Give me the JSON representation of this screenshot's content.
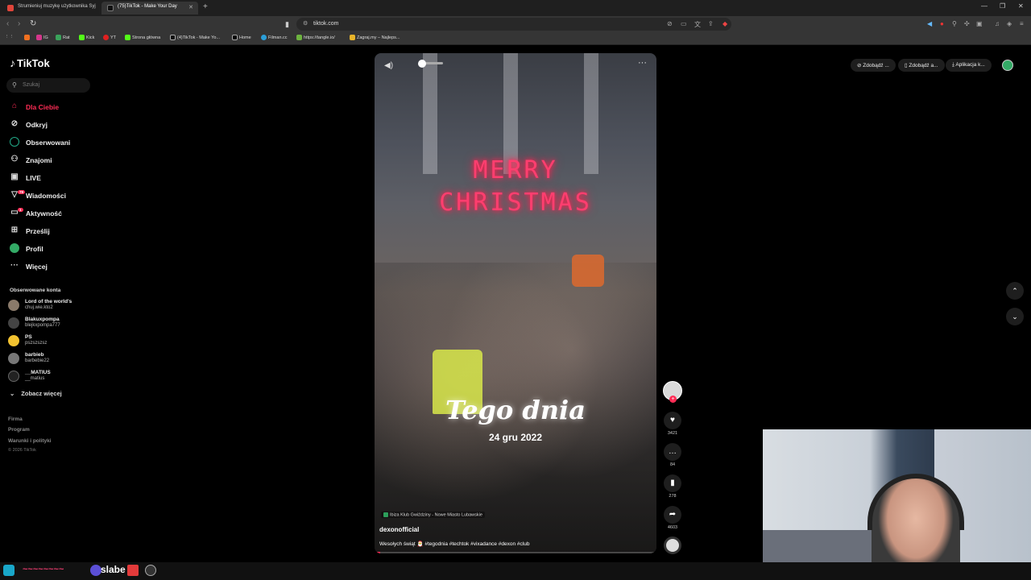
{
  "browser": {
    "tabs": [
      {
        "label": "Strumieniuj muzykę użytkownika Syj"
      },
      {
        "label": "(75)TikTok - Make Your Day"
      }
    ],
    "url": "tiktok.com",
    "bookmarks": [
      "IG",
      "Rat",
      "Kick",
      "YT",
      "Strona główna",
      "(4)TikTok - Make Yo...",
      "Home",
      "Filman.cc",
      "https://tangle.io/",
      "Zagraj.my – Najleps..."
    ]
  },
  "sidebar": {
    "logo": "TikTok",
    "search_placeholder": "Szukaj",
    "menu": [
      {
        "label": "Dla Ciebie",
        "icon": "home-icon"
      },
      {
        "label": "Odkryj",
        "icon": "compass-icon"
      },
      {
        "label": "Obserwowani",
        "icon": "following-icon"
      },
      {
        "label": "Znajomi",
        "icon": "friends-icon"
      },
      {
        "label": "LIVE",
        "icon": "live-icon"
      },
      {
        "label": "Wiadomości",
        "icon": "messages-icon",
        "badge": "79"
      },
      {
        "label": "Aktywność",
        "icon": "activity-icon",
        "badge": "1"
      },
      {
        "label": "Prześlij",
        "icon": "upload-icon"
      },
      {
        "label": "Profil",
        "icon": "profile-icon"
      },
      {
        "label": "Więcej",
        "icon": "more-icon"
      }
    ],
    "followed_title": "Obserwowane konta",
    "followed": [
      {
        "name": "Lord of the world's",
        "handle": "chuj.wie.kto2"
      },
      {
        "name": "Blakuxpompa",
        "handle": "blejkxpompa777"
      },
      {
        "name": "PS",
        "handle": "pszszszsz"
      },
      {
        "name": "barbieb",
        "handle": "barbebie22"
      },
      {
        "name": "__MATIUS",
        "handle": "__matius"
      }
    ],
    "see_more": "Zobacz więcej",
    "footer": [
      "Firma",
      "Program",
      "Warunki i polityki"
    ],
    "copyright": "© 2026 TikTok"
  },
  "topbar": {
    "buttons": [
      "Zdobądź ...",
      "Zdobądź a...",
      "Aplikacja k..."
    ]
  },
  "video": {
    "overlay_line1": "MERRY",
    "overlay_line2": "CHRISTMAS",
    "overlay_title": "Tego dnia",
    "overlay_date": "24 gru 2022",
    "location": "Ibiza Klub Gwiździny - Nowe Miasto Lubawskie",
    "author": "dexonofficial",
    "caption": "Wesołych świąt 🎅 #tegodnia #techtok #vixadance #dexon #club",
    "progress": 0.02
  },
  "actions": {
    "likes": "3421",
    "comments": "84",
    "saves": "278",
    "shares": "4603"
  },
  "taskbar": {
    "text": "slabe"
  }
}
